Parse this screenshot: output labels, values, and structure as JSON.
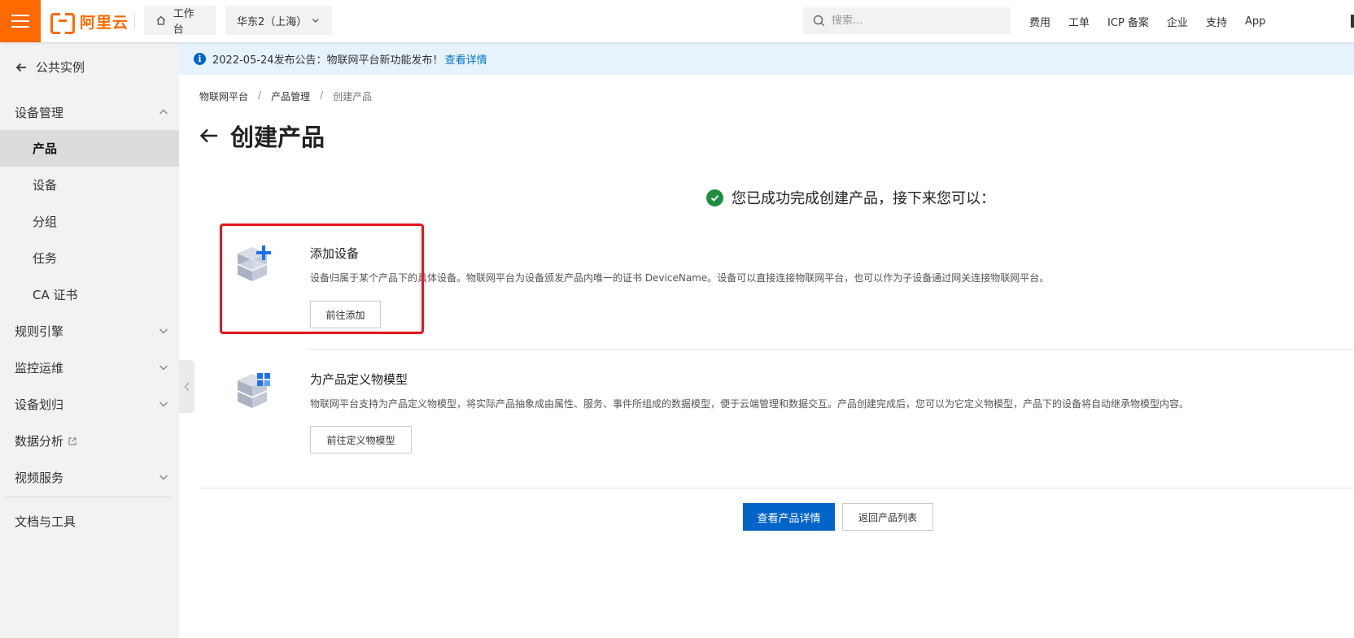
{
  "topbar": {
    "brand": "阿里云",
    "workbench": "工作台",
    "region": "华东2（上海）",
    "search_placeholder": "搜索...",
    "nav": [
      "费用",
      "工单",
      "ICP 备案",
      "企业",
      "支持",
      "App"
    ],
    "accent": "#ff6a00"
  },
  "sidebar": {
    "back": "公共实例",
    "items": [
      {
        "label": "设备管理"
      },
      {
        "label": "产品"
      },
      {
        "label": "设备"
      },
      {
        "label": "分组"
      },
      {
        "label": "任务"
      },
      {
        "label": "CA 证书"
      },
      {
        "label": "规则引擎"
      },
      {
        "label": "监控运维"
      },
      {
        "label": "设备划归"
      },
      {
        "label": "数据分析"
      },
      {
        "label": "视频服务"
      },
      {
        "label": "文档与工具"
      }
    ]
  },
  "notice": {
    "text": "2022-05-24发布公告：物联网平台新功能发布！",
    "link": "查看详情"
  },
  "breadcrumb": [
    "物联网平台",
    "产品管理",
    "创建产品"
  ],
  "page_title": "创建产品",
  "success_text": "您已成功完成创建产品，接下来您可以：",
  "cards": [
    {
      "title": "添加设备",
      "desc": "设备归属于某个产品下的具体设备。物联网平台为设备颁发产品内唯一的证书 DeviceName。设备可以直接连接物联网平台，也可以作为子设备通过网关连接物联网平台。",
      "button": "前往添加"
    },
    {
      "title": "为产品定义物模型",
      "desc": "物联网平台支持为产品定义物模型，将实际产品抽象成由属性、服务、事件所组成的数据模型，便于云端管理和数据交互。产品创建完成后，您可以为它定义物模型，产品下的设备将自动继承物模型内容。",
      "button": "前往定义物模型"
    }
  ],
  "actions": {
    "primary": "查看产品详情",
    "secondary": "返回产品列表"
  },
  "colors": {
    "primary": "#0064c8",
    "success": "#1e8e3e",
    "highlight": "#e5161e"
  }
}
